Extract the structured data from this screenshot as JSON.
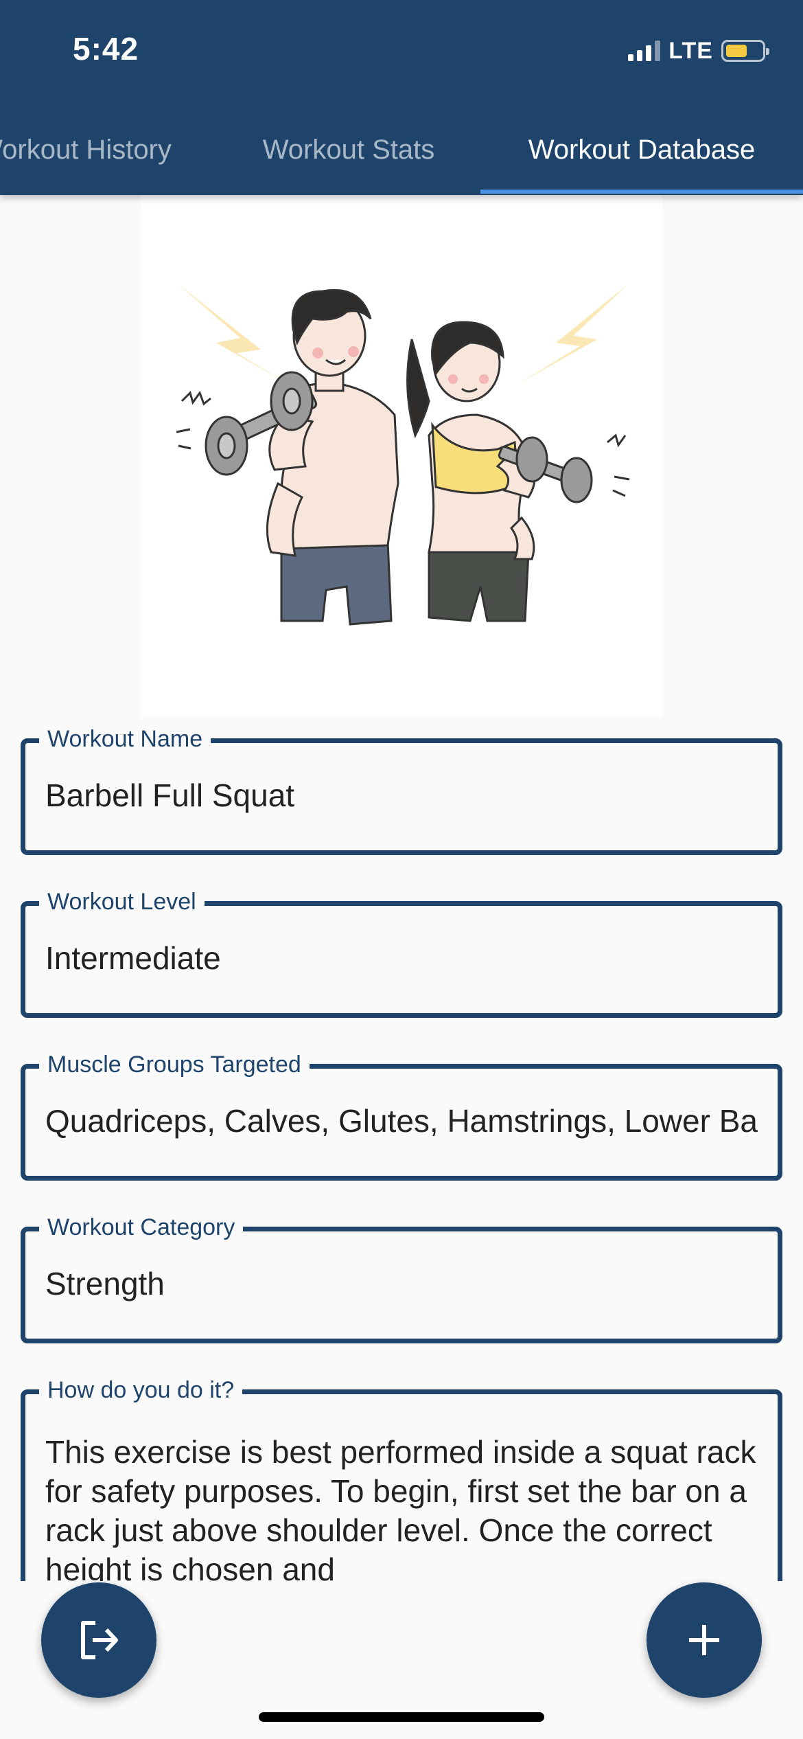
{
  "status_bar": {
    "time": "5:42",
    "network": "LTE",
    "battery_color": "#f5c842"
  },
  "tabs": [
    {
      "label": "Workout History",
      "active": false
    },
    {
      "label": "Workout Stats",
      "active": false
    },
    {
      "label": "Workout Database",
      "active": true
    }
  ],
  "illustration": {
    "icon": "workout-couple-dumbbells-illustration"
  },
  "fields": {
    "workout_name": {
      "label": "Workout Name",
      "value": "Barbell Full Squat"
    },
    "workout_level": {
      "label": "Workout Level",
      "value": "Intermediate"
    },
    "muscle_groups": {
      "label": "Muscle Groups Targeted",
      "value": "Quadriceps, Calves, Glutes, Hamstrings, Lower Back"
    },
    "workout_category": {
      "label": "Workout Category",
      "value": "Strength"
    },
    "instructions": {
      "label": "How do you do it?",
      "value": "This exercise is best performed inside a squat rack for safety purposes. To begin, first set the bar on a rack just above shoulder level. Once the correct height is chosen and"
    }
  },
  "buttons": {
    "logout_icon": "logout-icon",
    "add_icon": "plus-icon"
  },
  "colors": {
    "primary": "#1e446c",
    "tab_indicator": "#4a90e2",
    "background": "#fafafa"
  }
}
